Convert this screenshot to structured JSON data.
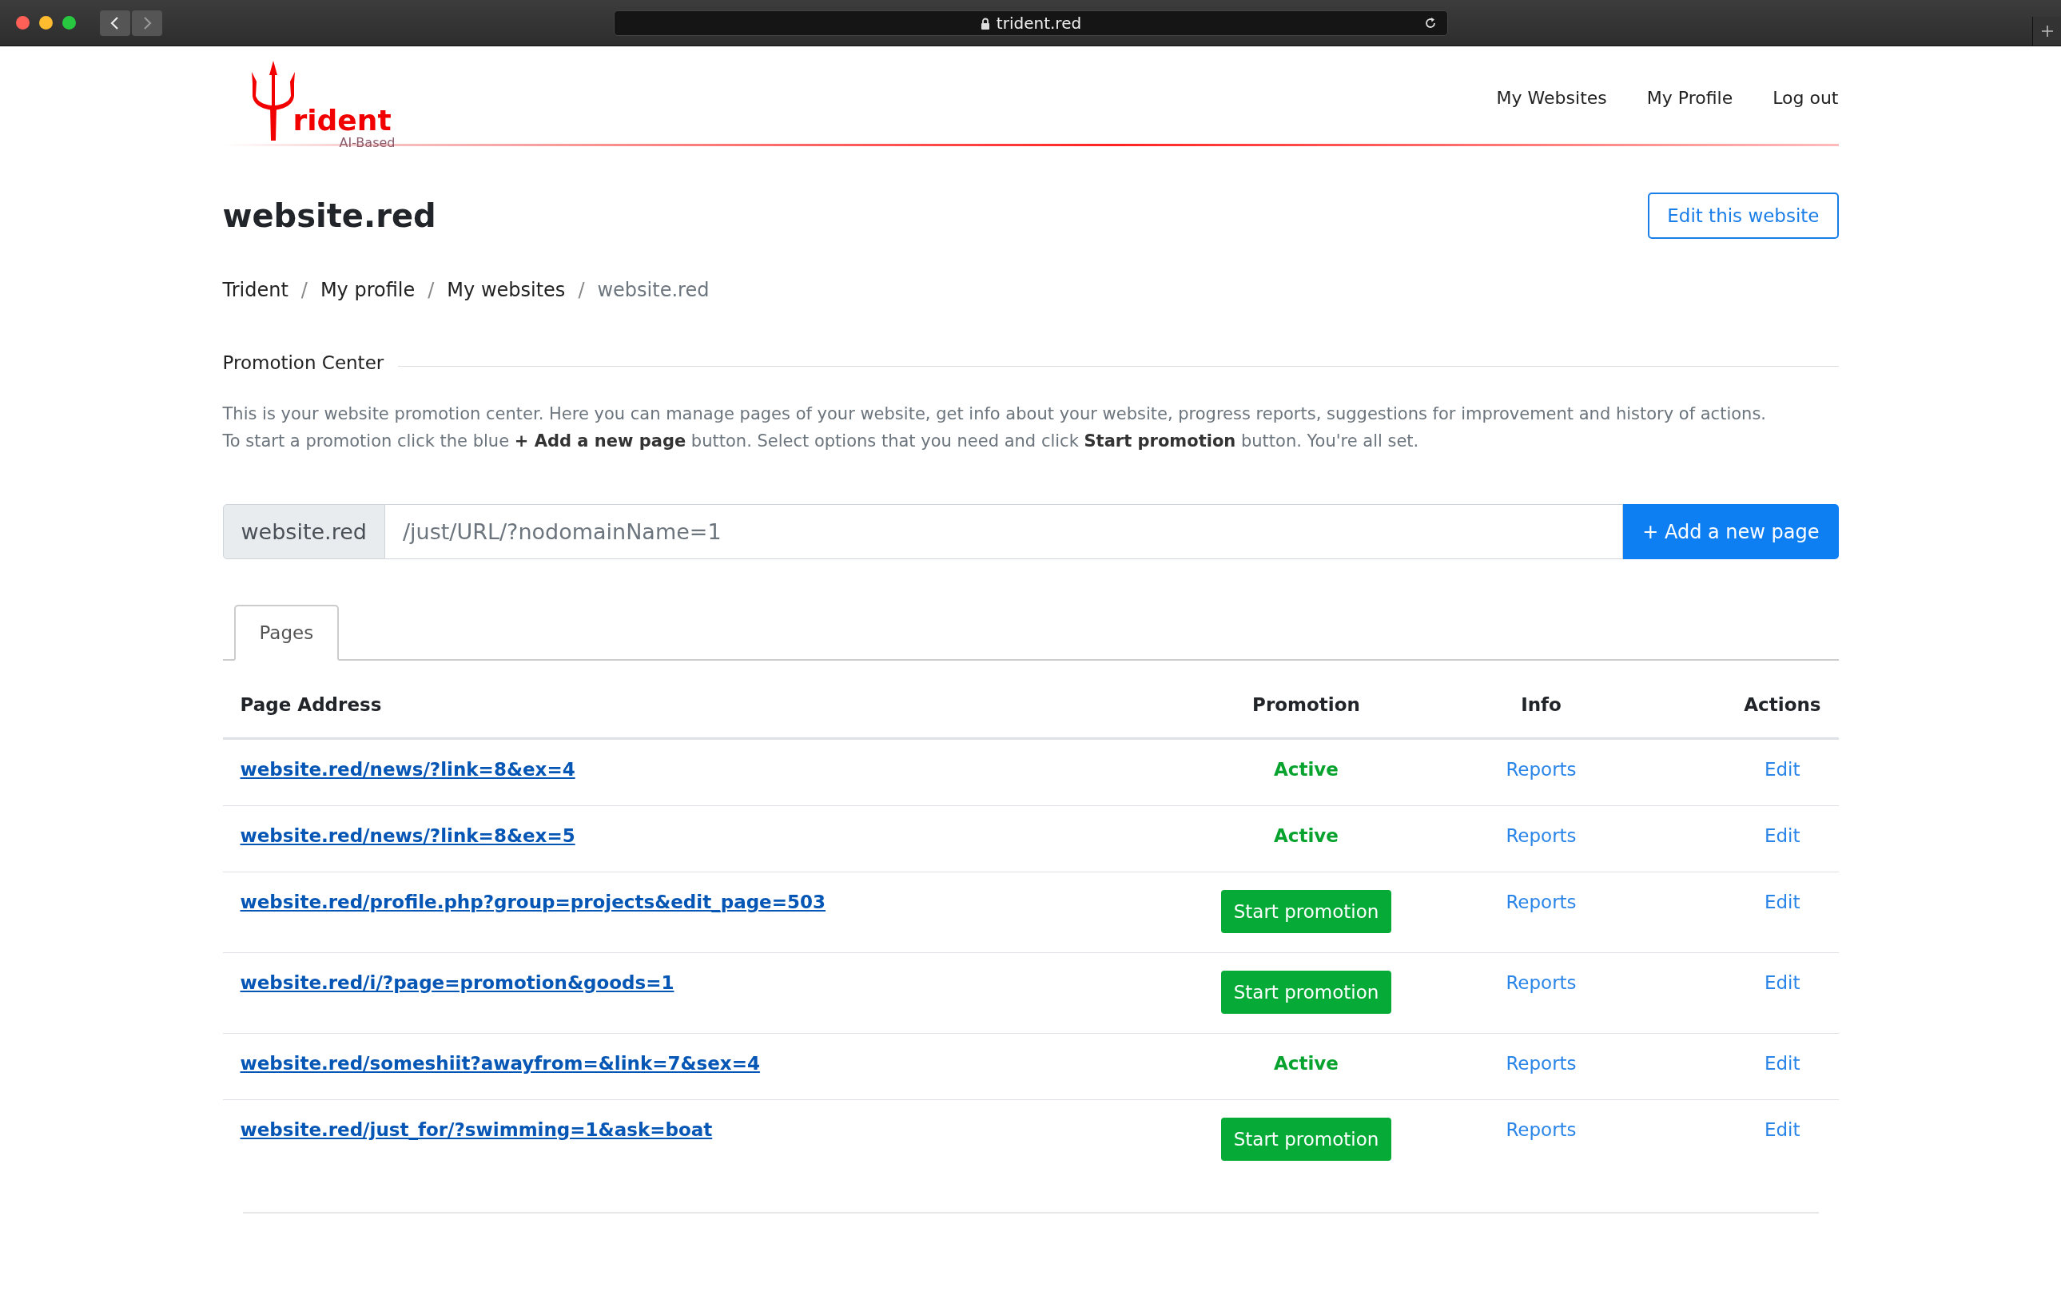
{
  "browser": {
    "address": "trident.red"
  },
  "logo": {
    "name": "rident",
    "tagline": "AI-Based"
  },
  "nav": [
    {
      "label": "My Websites"
    },
    {
      "label": "My Profile"
    },
    {
      "label": "Log out"
    }
  ],
  "page": {
    "title": "website.red",
    "edit_button": "Edit this website"
  },
  "breadcrumb": [
    {
      "label": "Trident",
      "current": false
    },
    {
      "label": "My profile",
      "current": false
    },
    {
      "label": "My websites",
      "current": false
    },
    {
      "label": "website.red",
      "current": true
    }
  ],
  "breadcrumb_separator": "/",
  "section": {
    "title": "Promotion Center",
    "description": [
      "This is your website promotion center. Here you can manage pages of your website, get info about your website, progress reports, suggestions for improvement and history of actions.",
      "To start a promotion click the blue **+ Add a new page** button. Select options that you need and click **Start promotion** button. You're all set."
    ]
  },
  "add_page": {
    "prefix": "website.red",
    "value": "/just/URL/?nodomainName=1",
    "button": "+ Add a new page"
  },
  "tabs": [
    {
      "label": "Pages",
      "selected": true
    }
  ],
  "table": {
    "columns": [
      "Page Address",
      "Promotion",
      "Info",
      "Actions"
    ],
    "rows": [
      {
        "address": "website.red/news/?link=8&ex=4",
        "promotion": {
          "kind": "status",
          "text": "Active"
        },
        "info": "Reports",
        "action": "Edit"
      },
      {
        "address": "website.red/news/?link=8&ex=5",
        "promotion": {
          "kind": "status",
          "text": "Active"
        },
        "info": "Reports",
        "action": "Edit"
      },
      {
        "address": "website.red/profile.php?group=projects&edit_page=503",
        "promotion": {
          "kind": "button",
          "text": "Start promotion"
        },
        "info": "Reports",
        "action": "Edit"
      },
      {
        "address": "website.red/i/?page=promotion&goods=1",
        "promotion": {
          "kind": "button",
          "text": "Start promotion"
        },
        "info": "Reports",
        "action": "Edit"
      },
      {
        "address": "website.red/someshiit?awayfrom=&link=7&sex=4",
        "promotion": {
          "kind": "status",
          "text": "Active"
        },
        "info": "Reports",
        "action": "Edit"
      },
      {
        "address": "website.red/just_for/?swimming=1&ask=boat",
        "promotion": {
          "kind": "button",
          "text": "Start promotion"
        },
        "info": "Reports",
        "action": "Edit"
      }
    ]
  }
}
